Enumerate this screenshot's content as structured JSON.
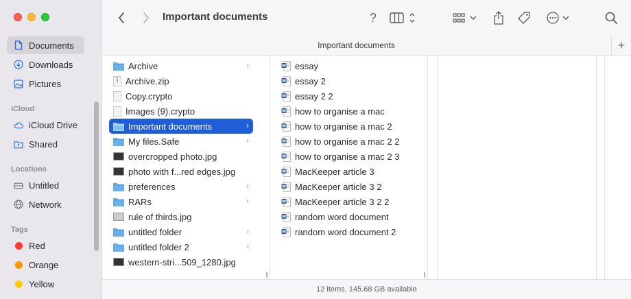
{
  "window": {
    "title": "Important documents"
  },
  "sidebar": {
    "favorites": [
      {
        "label": "Documents",
        "icon": "document-icon",
        "selected": true
      },
      {
        "label": "Downloads",
        "icon": "download-icon"
      },
      {
        "label": "Pictures",
        "icon": "pictures-icon"
      }
    ],
    "icloud_header": "iCloud",
    "icloud": [
      {
        "label": "iCloud Drive",
        "icon": "cloud-icon"
      },
      {
        "label": "Shared",
        "icon": "shared-folder-icon"
      }
    ],
    "locations_header": "Locations",
    "locations": [
      {
        "label": "Untitled",
        "icon": "disk-icon"
      },
      {
        "label": "Network",
        "icon": "globe-icon"
      }
    ],
    "tags_header": "Tags",
    "tags": [
      {
        "label": "Red",
        "color": "#ff3b30"
      },
      {
        "label": "Orange",
        "color": "#ff9500"
      },
      {
        "label": "Yellow",
        "color": "#ffcc00"
      }
    ]
  },
  "toolbar": {
    "back_icon": "chevron-left-icon",
    "forward_icon": "chevron-right-icon",
    "help": "?",
    "view_icon": "column-view-icon",
    "group_icon": "group-grid-icon",
    "share_icon": "share-icon",
    "tag_icon": "tag-icon",
    "more_icon": "ellipsis-circle-icon",
    "search_icon": "search-icon"
  },
  "pathbar": {
    "label": "Important documents",
    "add": "+"
  },
  "column1": [
    {
      "name": "Archive",
      "type": "folder",
      "chevron": true
    },
    {
      "name": "Archive.zip",
      "type": "zip"
    },
    {
      "name": "Copy.crypto",
      "type": "file"
    },
    {
      "name": "Images (9).crypto",
      "type": "file"
    },
    {
      "name": "Important documents",
      "type": "folder",
      "chevron": true,
      "selected": true
    },
    {
      "name": "My files.Safe",
      "type": "folder",
      "chevron": true
    },
    {
      "name": "overcropped photo.jpg",
      "type": "image"
    },
    {
      "name": "photo with f...red edges.jpg",
      "type": "image"
    },
    {
      "name": "preferences",
      "type": "folder",
      "chevron": true
    },
    {
      "name": "RARs",
      "type": "folder",
      "chevron": true
    },
    {
      "name": "rule of thirds.jpg",
      "type": "image"
    },
    {
      "name": "untitled folder",
      "type": "folder",
      "chevron": true
    },
    {
      "name": "untitled folder 2",
      "type": "folder",
      "chevron": true
    },
    {
      "name": "western-stri...509_1280.jpg",
      "type": "image"
    }
  ],
  "column2": [
    "essay",
    "essay 2",
    "essay 2 2",
    "how to organise a mac",
    "how to organise a mac 2",
    "how to organise a mac 2 2",
    "how to organise a mac 2 3",
    "MacKeeper article 3",
    "MacKeeper article 3 2",
    "MacKeeper article 3 2 2",
    "random word document",
    "random word document 2"
  ],
  "chevron_glyph": "›",
  "resize_glyph": "||",
  "status": "12 items, 145.68 GB available",
  "colors": {
    "accent": "#1f5ed8",
    "folder": "#69b1ec",
    "word": "#2b579a"
  }
}
